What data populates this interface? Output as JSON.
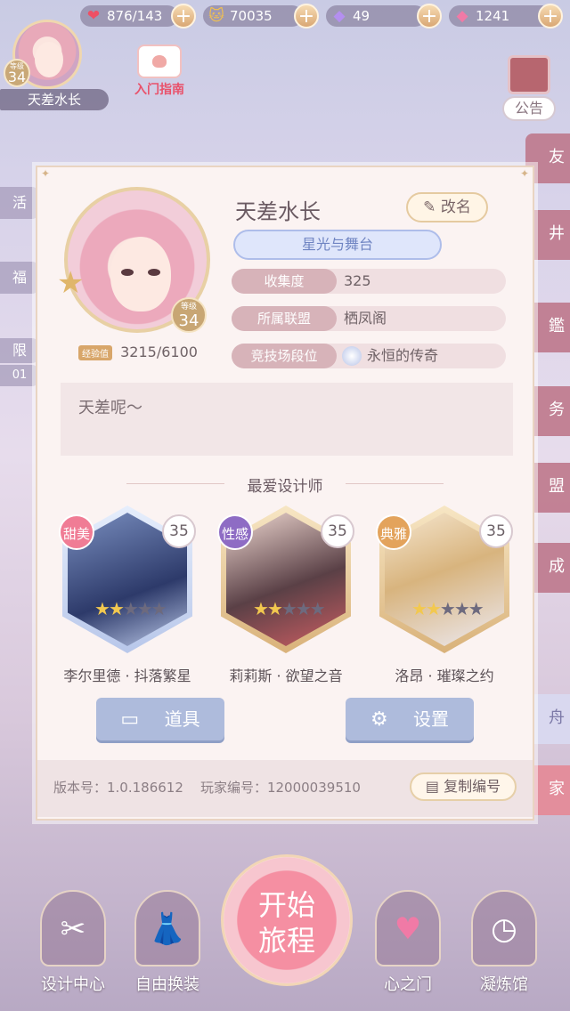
{
  "currencies": {
    "stamina": "876/143",
    "gold": "70035",
    "diamond": "49",
    "pink_diamond": "1241",
    "plus": "+"
  },
  "player": {
    "name": "天差水长",
    "level_label": "等级",
    "level": "34"
  },
  "guide_label": "入门指南",
  "notice_label": "公告",
  "side_tabs": [
    "友",
    "井",
    "鑑",
    "务",
    "盟",
    "成"
  ],
  "side_extra": [
    "舟",
    "家"
  ],
  "left_tabs": [
    "活",
    "福",
    "限",
    "01"
  ],
  "profile": {
    "name": "天差水长",
    "rename_label": "改名",
    "title_badge": "星光与舞台",
    "exp_tag": "经验值",
    "exp_value": "3215/6100",
    "level_label": "等级",
    "level": "34",
    "rows": [
      {
        "label": "收集度",
        "value": "325"
      },
      {
        "label": "所属联盟",
        "value": "栖凤阁"
      },
      {
        "label": "竞技场段位",
        "value": "永恒的传奇"
      }
    ],
    "signature": "天差呢～",
    "fav_title": "最爱设计师",
    "designers": [
      {
        "tag": "甜美",
        "level": "35",
        "name": "李尔里德 · 抖落繁星",
        "stars_on": 2,
        "stars_total": 5,
        "tag_color": "#f07c95"
      },
      {
        "tag": "性感",
        "level": "35",
        "name": "莉莉斯 · 欲望之音",
        "stars_on": 2,
        "stars_total": 5,
        "tag_color": "#8e6cc4"
      },
      {
        "tag": "典雅",
        "level": "35",
        "name": "洛昂 · 璀璨之约",
        "stars_on": 2,
        "stars_total": 5,
        "tag_color": "#e3a35c"
      }
    ],
    "items_label": "道具",
    "settings_label": "设置",
    "version": "版本号：1.0.186612",
    "player_id": "玩家编号：12000039510",
    "copy_label": "复制编号"
  },
  "nav": {
    "design_center": "设计中心",
    "free_dress": "自由换装",
    "start_line1": "开始",
    "start_line2": "旅程",
    "heart_gate": "心之门",
    "refine_hall": "凝炼馆"
  },
  "colors": {
    "accent_pink": "#f58fa2",
    "button_blue": "#aebbdc",
    "gold": "#d8a66a"
  }
}
